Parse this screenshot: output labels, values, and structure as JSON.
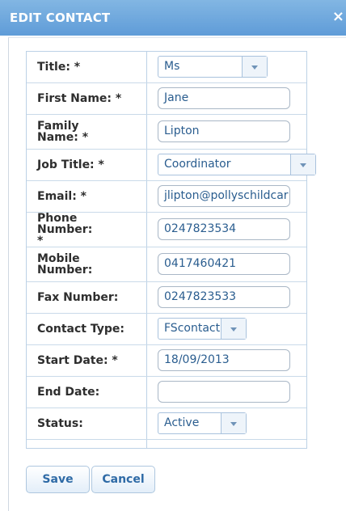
{
  "dialog": {
    "title": "EDIT CONTACT",
    "close_glyph": "×"
  },
  "fields": {
    "title": {
      "label": "Title: *",
      "value": "Ms"
    },
    "first_name": {
      "label": "First Name: *",
      "value": "Jane"
    },
    "family_name": {
      "label": "Family Name: *",
      "value": "Lipton"
    },
    "job_title": {
      "label": "Job Title: *",
      "value": "Coordinator"
    },
    "email": {
      "label": "Email: *",
      "value": "jlipton@pollyschildcar"
    },
    "phone": {
      "label": "Phone Number: *",
      "value": "0247823534"
    },
    "mobile": {
      "label": "Mobile Number:",
      "value": "0417460421"
    },
    "fax": {
      "label": "Fax Number:",
      "value": "0247823533"
    },
    "contact_type": {
      "label": "Contact Type:",
      "value": "FScontact"
    },
    "start_date": {
      "label": "Start Date: *",
      "value": "18/09/2013"
    },
    "end_date": {
      "label": "End Date:",
      "value": ""
    },
    "status": {
      "label": "Status:",
      "value": "Active"
    }
  },
  "buttons": {
    "save": "Save",
    "cancel": "Cancel"
  },
  "colors": {
    "titlebar": "#6fa9de",
    "input_text": "#2a5d8f",
    "button_text": "#2e6aa6"
  }
}
